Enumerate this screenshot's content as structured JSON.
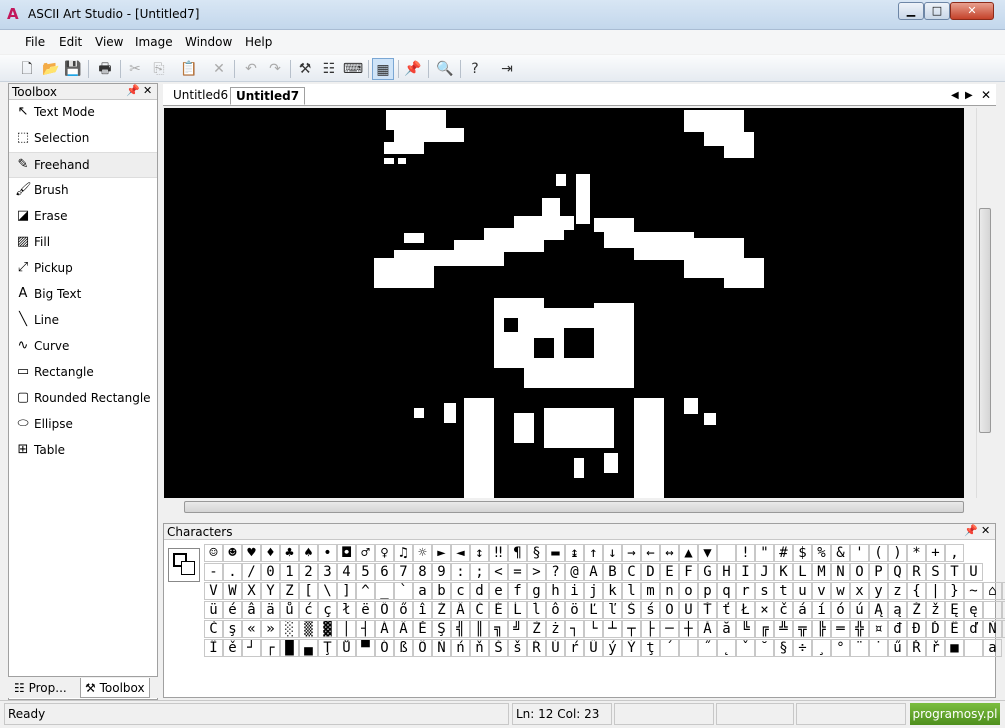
{
  "window": {
    "title": "ASCII Art Studio - [Untitled7]",
    "app_icon": "A",
    "min": "▁",
    "max": "□",
    "close": "✕"
  },
  "menu": [
    "File",
    "Edit",
    "View",
    "Image",
    "Window",
    "Help"
  ],
  "toolbar_icons": [
    "new-file-icon",
    "open-folder-icon",
    "save-icon",
    "print-icon",
    "cut-icon",
    "copy-icon",
    "paste-icon",
    "delete-icon",
    "undo-icon",
    "redo-icon",
    "tools-icon",
    "properties-icon",
    "keyboard-icon",
    "grid-icon",
    "pin-icon",
    "zoom-icon",
    "help-icon",
    "exit-icon"
  ],
  "toolbox": {
    "title": "Toolbox",
    "items": [
      {
        "label": "Text Mode",
        "icon": "↖"
      },
      {
        "label": "Selection",
        "icon": "⬚"
      },
      {
        "label": "Freehand",
        "icon": "✎"
      },
      {
        "label": "Brush",
        "icon": "🖌"
      },
      {
        "label": "Erase",
        "icon": "◪"
      },
      {
        "label": "Fill",
        "icon": "▨"
      },
      {
        "label": "Pickup",
        "icon": "⤢"
      },
      {
        "label": "Big Text",
        "icon": "A"
      },
      {
        "label": "Line",
        "icon": "╲"
      },
      {
        "label": "Curve",
        "icon": "∿"
      },
      {
        "label": "Rectangle",
        "icon": "▭"
      },
      {
        "label": "Rounded Rectangle",
        "icon": "▢"
      },
      {
        "label": "Ellipse",
        "icon": "⬭"
      },
      {
        "label": "Table",
        "icon": "⊞"
      }
    ],
    "selected": "Freehand"
  },
  "bottom_tabs": [
    "Prop...",
    "Toolbox"
  ],
  "doc_tabs": [
    "Untitled6",
    "Untitled7"
  ],
  "active_doc": "Untitled7",
  "characters": {
    "title": "Characters",
    "rows": [
      "☺☻♥♦♣♠•◘♂♀♫☼►◄↕‼¶§▬↨↑↓→←↔▲▼ !\"#$%&'()*+,",
      "-./0123456789:;<=>?@ABCDEFGHIJKLMNOPQRSTU",
      "VWXYZ[\\]^_`abcdefghijklmnopqrstuvwxyz{|}~⌂Ç",
      "üéâäůćçłëŐőîŹÄĆÉĹĺôöĽľŚśÖÜŤťŁ×čáíóúĄąŽžĘę ź",
      "Čş«»░▒▓│┤ÁÂĚŞ╣║╗╝Żż┐└┴┬├─┼Ăă╚╔╩╦╠═╬¤đĐĎËďŇÍ",
      "Îě┘┌█▄ŢŮ▀ÓßÔŃńňŠšŔÚŕŰýÝţ´­˝˛ˇ˘§÷¸°¨˙űŘř■ a"
    ]
  },
  "status": {
    "ready": "Ready",
    "position": "Ln: 12  Col: 23",
    "brand": "programosy.pl"
  }
}
